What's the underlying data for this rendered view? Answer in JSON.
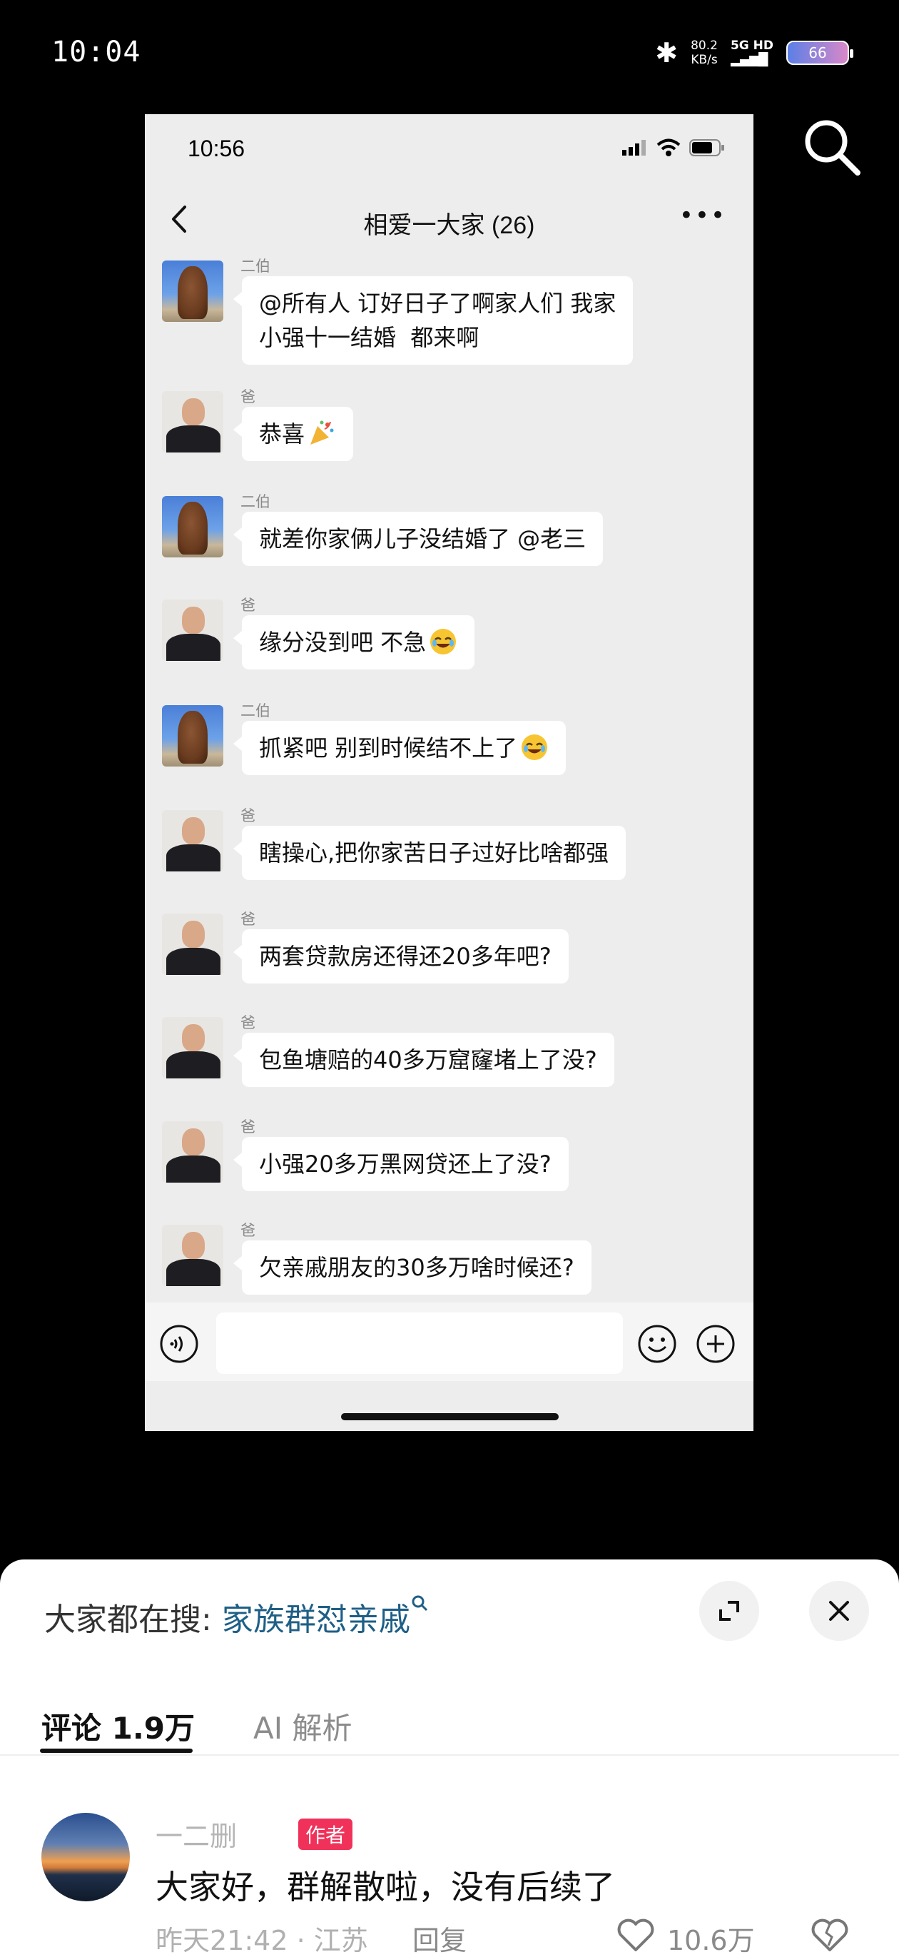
{
  "os_status": {
    "time": "10:04",
    "net_speed": "80.2",
    "net_unit": "KB/s",
    "network": "5G HD",
    "battery": "66"
  },
  "phone": {
    "status_time": "10:56",
    "chat_title": "相爱一大家 (26)",
    "messages": [
      {
        "sender": "二伯",
        "text": "@所有人 订好日子了啊家人们 我家\n小强十一结婚  都来啊"
      },
      {
        "sender": "爸",
        "text": "恭喜"
      },
      {
        "sender": "二伯",
        "text": "就差你家俩儿子没结婚了 @老三"
      },
      {
        "sender": "爸",
        "text": "缘分没到吧 不急"
      },
      {
        "sender": "二伯",
        "text": "抓紧吧 别到时候结不上了"
      },
      {
        "sender": "爸",
        "text": "瞎操心,把你家苦日子过好比啥都强"
      },
      {
        "sender": "爸",
        "text": "两套贷款房还得还20多年吧?"
      },
      {
        "sender": "爸",
        "text": "包鱼塘赔的40多万窟窿堵上了没?"
      },
      {
        "sender": "爸",
        "text": "小强20多万黑网贷还上了没?"
      },
      {
        "sender": "爸",
        "text": "欠亲戚朋友的30多万啥时候还?"
      }
    ]
  },
  "sheet": {
    "search_prefix": "大家都在搜:",
    "search_term": "家族群怼亲戚",
    "tab_comments": "评论 1.9万",
    "tab_ai": "AI 解析"
  },
  "comment": {
    "username": "一二删",
    "author_badge": "作者",
    "text": "大家好，群解散啦，没有后续了",
    "meta": "昨天21:42 · 江苏",
    "reply": "回复",
    "likes": "10.6万"
  }
}
